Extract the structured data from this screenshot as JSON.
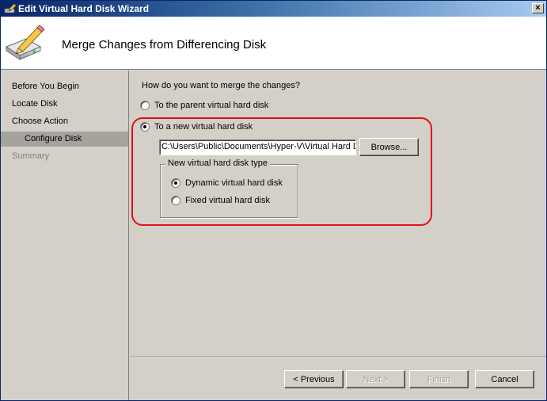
{
  "window": {
    "title": "Edit Virtual Hard Disk Wizard",
    "close_label": "×"
  },
  "header": {
    "title": "Merge Changes from Differencing Disk",
    "icon": "disk-pencil-icon"
  },
  "nav": {
    "items": [
      {
        "label": "Before You Begin",
        "state": "normal"
      },
      {
        "label": "Locate Disk",
        "state": "normal"
      },
      {
        "label": "Choose Action",
        "state": "normal"
      },
      {
        "label": "Configure Disk",
        "state": "active"
      },
      {
        "label": "Summary",
        "state": "disabled"
      }
    ]
  },
  "main": {
    "question": "How do you want to merge the changes?",
    "options": [
      {
        "label": "To the parent virtual hard disk",
        "selected": false
      },
      {
        "label": "To a new virtual hard disk",
        "selected": true
      }
    ],
    "path_value": "C:\\Users\\Public\\Documents\\Hyper-V\\Virtual Hard Di",
    "browse_label": "Browse...",
    "disk_type": {
      "legend": "New virtual hard disk type",
      "options": [
        {
          "label": "Dynamic virtual hard disk",
          "selected": true
        },
        {
          "label": "Fixed virtual hard disk",
          "selected": false
        }
      ]
    },
    "highlight_color": "#e0101e"
  },
  "footer": {
    "previous_label": "< Previous",
    "next_label": "Next >",
    "finish_label": "Finish",
    "cancel_label": "Cancel"
  }
}
